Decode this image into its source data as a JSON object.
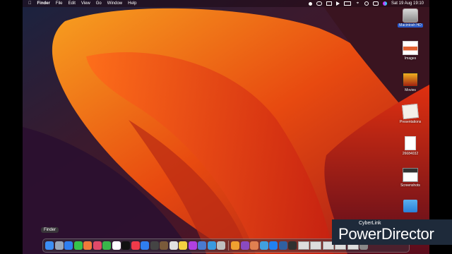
{
  "menubar": {
    "apple_icon": "apple-icon",
    "items": [
      "Finder",
      "File",
      "Edit",
      "View",
      "Go",
      "Window",
      "Help"
    ],
    "clock": "Sat 19 Aug  19:10"
  },
  "desktop": {
    "icons": [
      {
        "label": "Macintosh HD",
        "icon": "hard-drive-icon",
        "selected": true
      },
      {
        "label": "Images",
        "icon": "folder-images-icon"
      },
      {
        "label": "Movies",
        "icon": "folder-movies-icon"
      },
      {
        "label": "Presentations",
        "icon": "folder-presentations-icon"
      },
      {
        "label": "26684032",
        "icon": "document-icon"
      },
      {
        "label": "Screenshots",
        "icon": "folder-screenshots-icon"
      },
      {
        "label": "",
        "icon": "folder-icon"
      }
    ]
  },
  "dock": {
    "tooltip": "Finder",
    "colors": [
      "#3c8ef5",
      "#9aa6b8",
      "#2f7ef0",
      "#36c24a",
      "#f07a3a",
      "#e04a6a",
      "#3ab54a",
      "#ffffff",
      "#111111",
      "#f03a4a",
      "#2f7ef0",
      "#444444",
      "#7a5a3a",
      "#e0e0e0",
      "#f5d040",
      "#b040e0",
      "#4a7ad0",
      "#3a9ae0",
      "#c0c0c0",
      "#f0a030",
      "#8a4ac0",
      "#e08050",
      "#40a0e0",
      "#2080f0",
      "#3060a0",
      "#303030"
    ]
  },
  "watermark": {
    "line1": "CyberLink",
    "line2": "PowerDirector"
  }
}
